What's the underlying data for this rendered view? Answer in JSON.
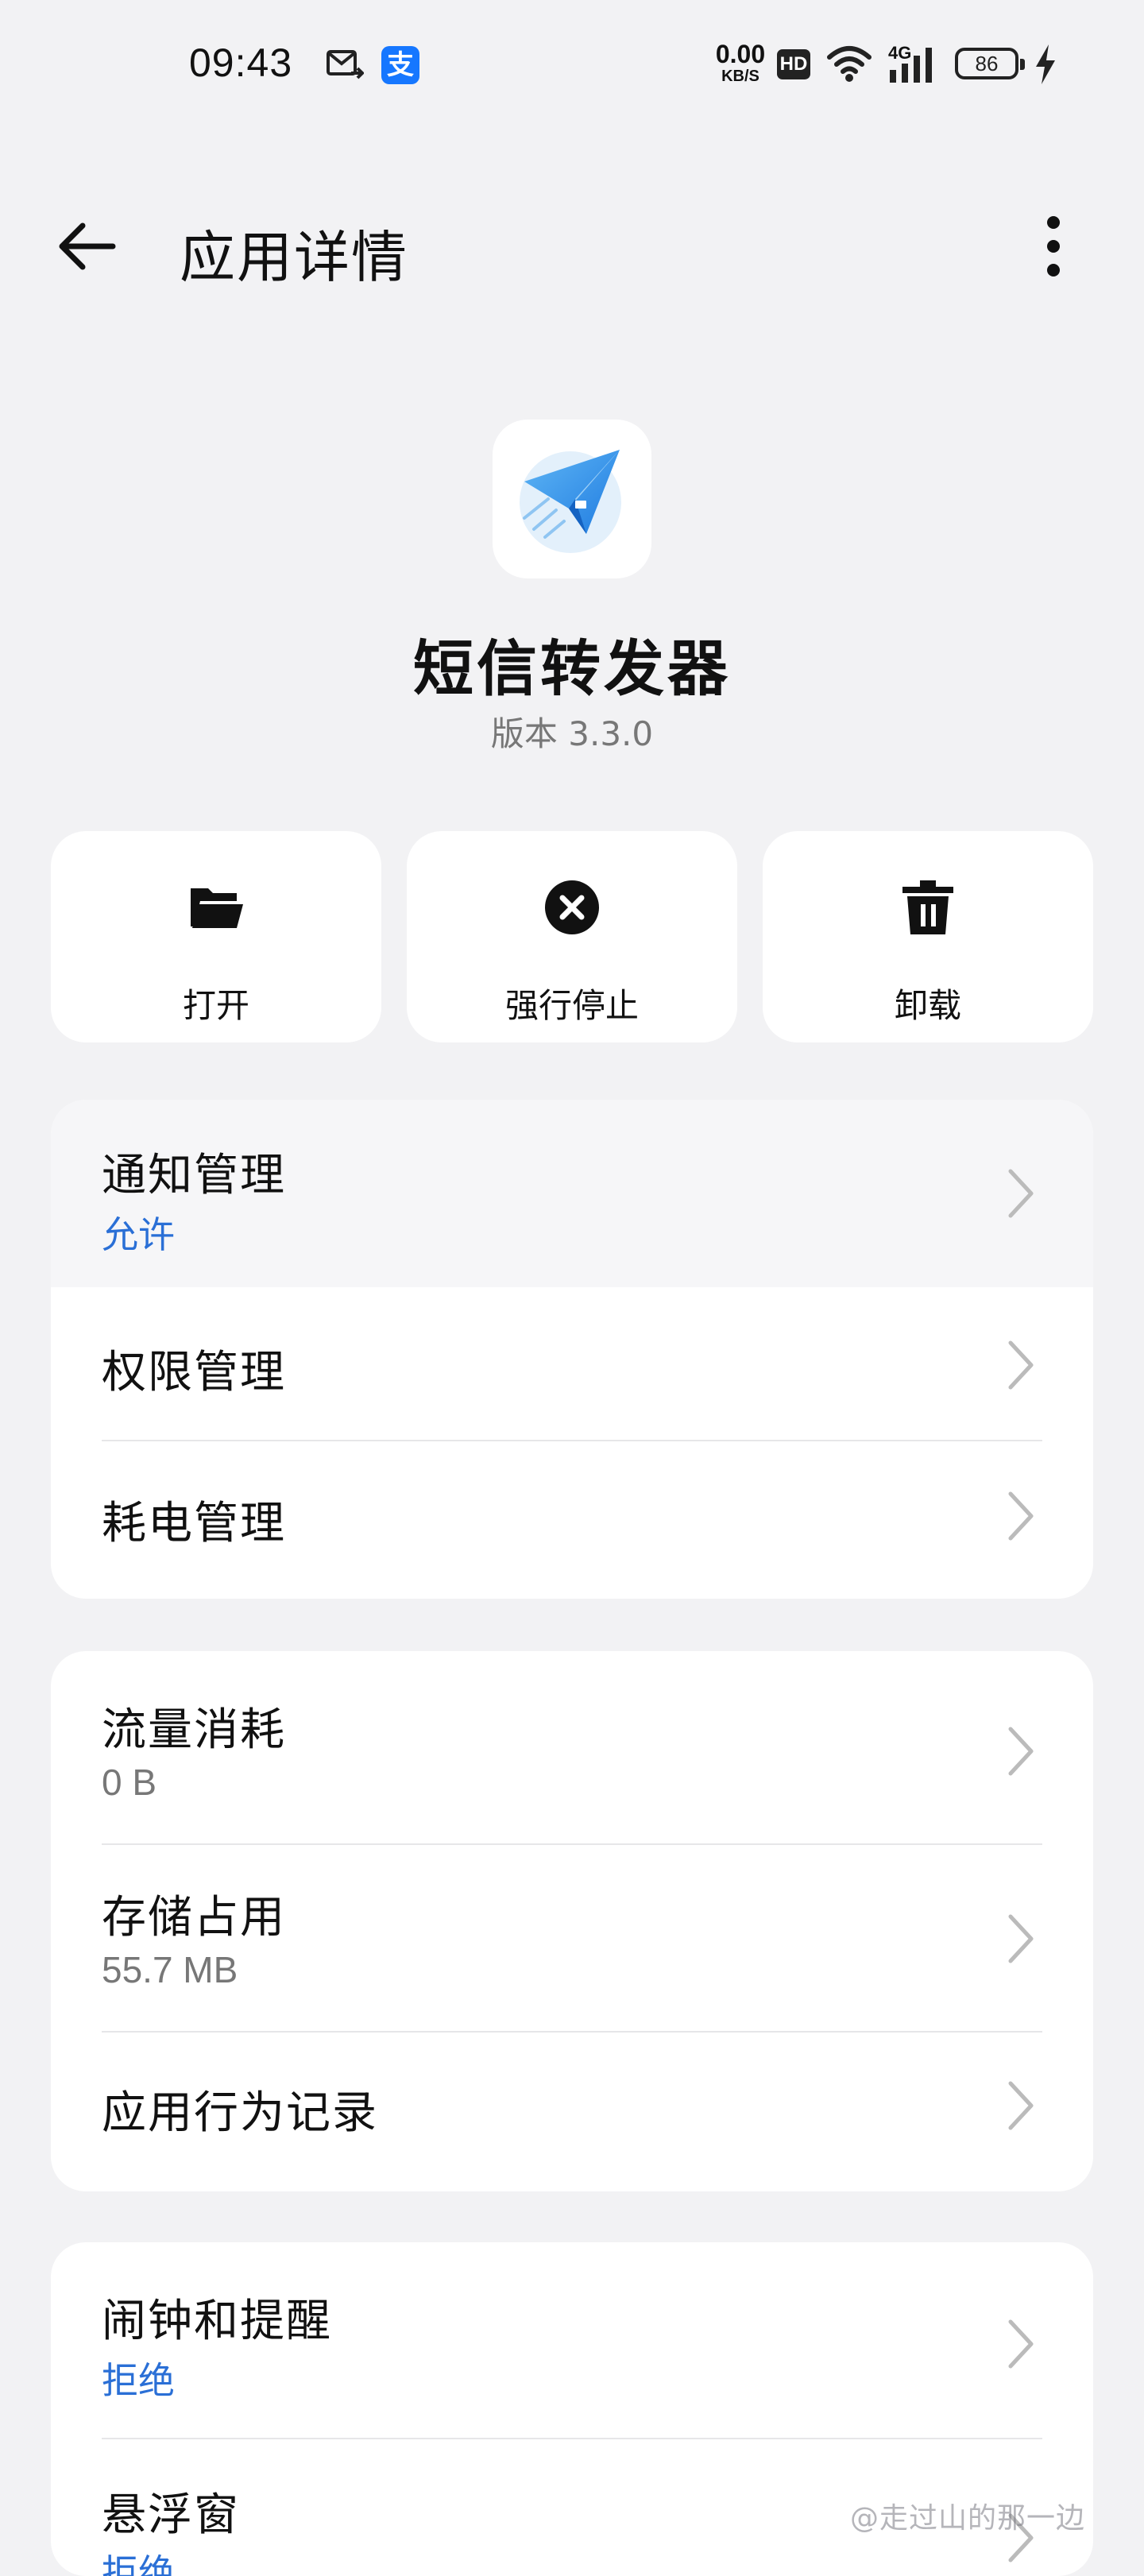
{
  "status_bar": {
    "time": "09:43",
    "net_speed_value": "0.00",
    "net_speed_unit": "KB/S",
    "hd_badge": "HD",
    "signal_type": "4G",
    "battery_level": "86",
    "icons": [
      "mail-icon",
      "alipay-icon",
      "wifi-icon",
      "signal-icon",
      "charging-icon"
    ]
  },
  "header": {
    "title": "应用详情"
  },
  "app": {
    "name": "短信转发器",
    "version": "版本 3.3.0"
  },
  "actions": [
    {
      "label": "打开",
      "icon": "folder-open-icon"
    },
    {
      "label": "强行停止",
      "icon": "close-circle-icon"
    },
    {
      "label": "卸载",
      "icon": "trash-icon"
    }
  ],
  "card1": [
    {
      "title": "通知管理",
      "sub": "允许"
    },
    {
      "title": "权限管理"
    },
    {
      "title": "耗电管理"
    }
  ],
  "card2": [
    {
      "title": "流量消耗",
      "sub": "0 B"
    },
    {
      "title": "存储占用",
      "sub": "55.7 MB"
    },
    {
      "title": "应用行为记录"
    }
  ],
  "card3": [
    {
      "title": "闹钟和提醒",
      "sub": "拒绝"
    },
    {
      "title": "悬浮窗",
      "sub": "拒绝"
    }
  ],
  "watermark": "@走过山的那一边",
  "colors": {
    "background": "#f2f2f4",
    "card": "#ffffff",
    "accent_blue": "#2a6fd6",
    "secondary_text": "#777777"
  }
}
